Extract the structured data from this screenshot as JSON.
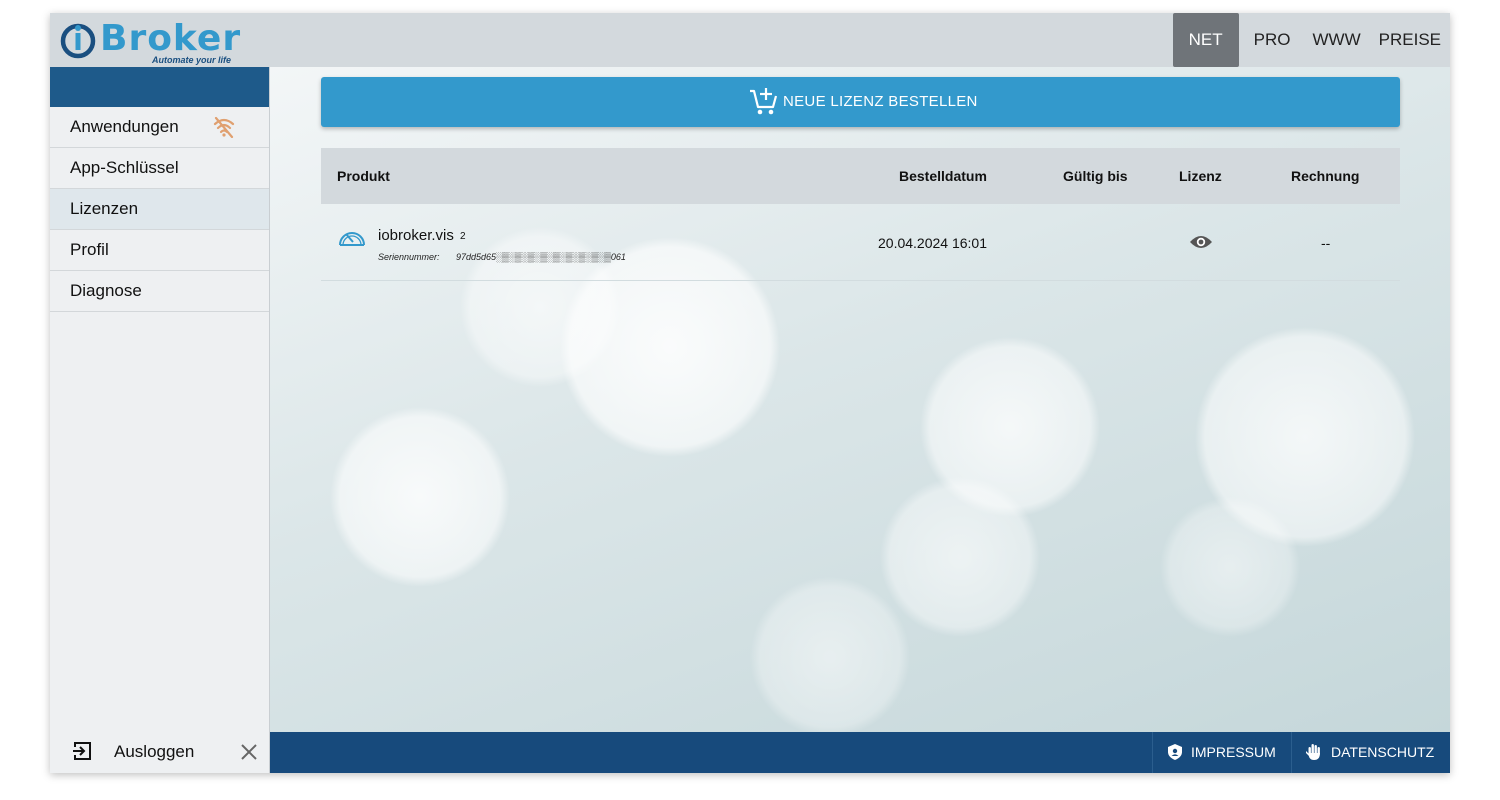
{
  "logo": {
    "name": "Broker",
    "tagline": "Automate your life"
  },
  "nav": [
    {
      "label": "NET",
      "active": true
    },
    {
      "label": "PRO"
    },
    {
      "label": "WWW"
    },
    {
      "label": "PREISE"
    }
  ],
  "sidebar": {
    "items": [
      {
        "label": "Anwendungen"
      },
      {
        "label": "App-Schlüssel"
      },
      {
        "label": "Lizenzen",
        "active": true
      },
      {
        "label": "Profil"
      },
      {
        "label": "Diagnose"
      }
    ],
    "logout_label": "Ausloggen"
  },
  "main": {
    "order_button": "NEUE LIZENZ BESTELLEN",
    "table": {
      "headers": {
        "product": "Produkt",
        "order_date": "Bestelldatum",
        "valid_until": "Gültig bis",
        "license": "Lizenz",
        "invoice": "Rechnung"
      },
      "rows": [
        {
          "product": "iobroker.vis",
          "version": "2",
          "serial_label": "Seriennummer:",
          "serial_value": "97dd5d65░▒░▒░▒░▒░▒░▒░▒░▒░▒061",
          "order_date": "20.04.2024 16:01",
          "valid_until": "",
          "invoice": "--"
        }
      ]
    }
  },
  "footer": {
    "impressum": "IMPRESSUM",
    "privacy": "DATENSCHUTZ"
  },
  "colors": {
    "brand": "#3399cc",
    "header_bg": "#d3d9dd",
    "nav_active_bg": "#6f7479",
    "sidebar_head": "#1e5a8a",
    "footer_bg": "#174a7c",
    "wifi_off": "#e0a070"
  },
  "icons": {
    "logo": "iobroker-logo-icon",
    "anwendungen_status": "wifi-off-icon",
    "logout": "logout-icon",
    "close": "close-icon",
    "order": "cart-plus-icon",
    "product": "gauge-icon",
    "license_view": "eye-icon",
    "impressum": "shield-icon",
    "privacy": "hand-icon"
  }
}
